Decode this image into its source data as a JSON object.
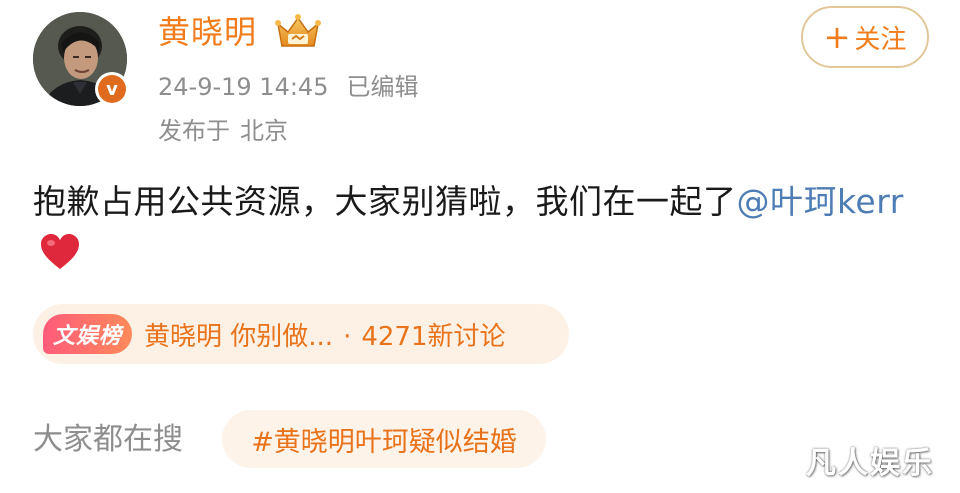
{
  "author": {
    "name": "黄晓明",
    "verified_mark": "v",
    "crown_icon": "crown-vip-icon"
  },
  "post_meta": {
    "timestamp": "24-9-19 14:45",
    "edited": "已编辑",
    "location_prefix": "发布于",
    "location": "北京"
  },
  "follow_button": {
    "plus": "+",
    "label": "关注"
  },
  "post": {
    "text": "抱歉占用公共资源，大家别猜啦，我们在一起了",
    "mention": "@叶珂kerr",
    "emoji": "heart-icon"
  },
  "hot_topic": {
    "tag": "文娱榜",
    "title": "黄晓明 你别做...",
    "separator": "·",
    "discussion": "4271新讨论"
  },
  "search": {
    "label": "大家都在搜",
    "topic": "#黄晓明叶珂疑似结婚"
  },
  "watermark": "凡人娱乐",
  "colors": {
    "accent": "#f07c1c",
    "mention": "#4d7db4",
    "meta_gray": "#8e8e8e",
    "heart": "#e0283c"
  }
}
